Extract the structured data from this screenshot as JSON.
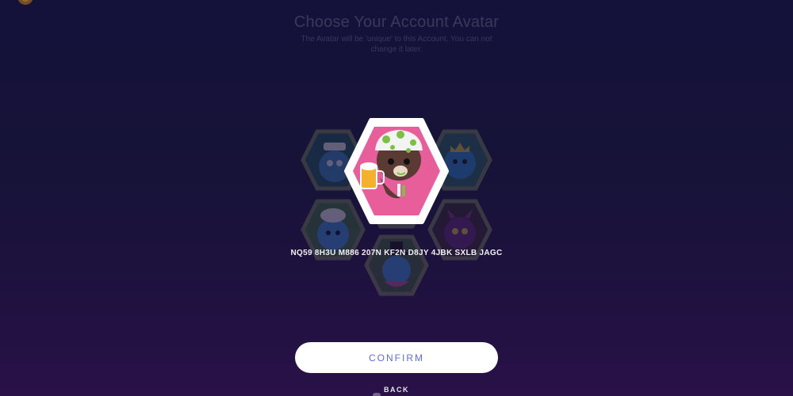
{
  "header": {
    "title": "Choose Your Account Avatar",
    "subtitle": "The Avatar will be 'unique' to this Account. You can not change it later.",
    "logo": "coin-logo-icon"
  },
  "avatars": {
    "selected": "bear-with-beer-avatar",
    "options": [
      "cowboy-monster-avatar",
      "king-monster-avatar",
      "chef-monster-avatar",
      "skateboard-avatar",
      "dark-horned-monster-avatar",
      "tophat-monster-avatar"
    ],
    "colors": {
      "selected_fill": "#e85e9a",
      "selected_ring": "#ffffff",
      "option_border": "#7d8a5a"
    }
  },
  "account": {
    "address": "NQ59 8H3U M886 207N KF2N D8JY 4JBK SXLB JAGC"
  },
  "actions": {
    "confirm_label": "CONFIRM",
    "back_label": "BACK"
  },
  "theme": {
    "accent": "#5c6be8",
    "background_top": "#14123a",
    "background_bottom": "#2a1148"
  }
}
